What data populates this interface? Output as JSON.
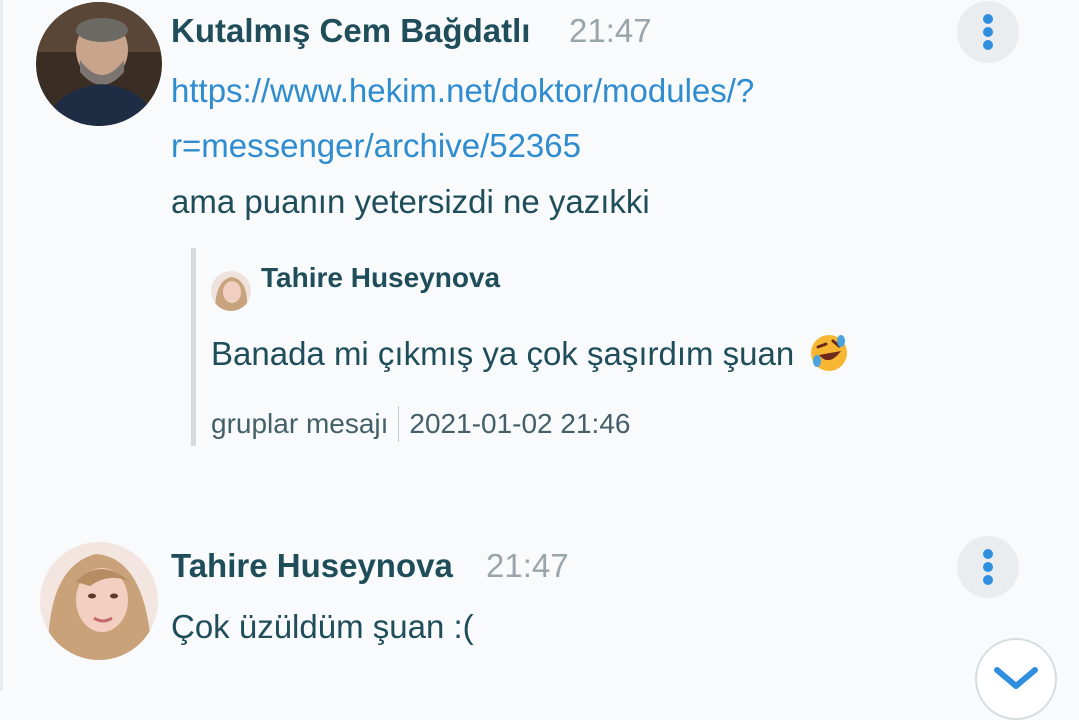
{
  "messages": [
    {
      "sender": "Kutalmış Cem Bağdatlı",
      "time": "21:47",
      "link_line1": "https://www.hekim.net/doktor/modules/?",
      "link_line2": "r=messenger/archive/52365",
      "text": "ama puanın yetersizdi ne yazıkki",
      "quote": {
        "sender": "Tahire Huseynova",
        "text": "Banada mi çıkmış ya çok şaşırdım şuan",
        "emoji": "rolling-on-floor-laughing-emoji",
        "source": "gruplar mesajı",
        "timestamp": "2021-01-02 21:46"
      }
    },
    {
      "sender": "Tahire Huseynova",
      "time": "21:47",
      "text": "Çok üzüldüm şuan :("
    }
  ],
  "icons": {
    "more": "more-vertical-icon",
    "scroll_down": "chevron-down-icon"
  },
  "colors": {
    "background": "#f8fafc",
    "sender": "#1f4e5a",
    "link": "#2f8ccf",
    "accent": "#2f8fde",
    "time": "#9aa5ab"
  }
}
